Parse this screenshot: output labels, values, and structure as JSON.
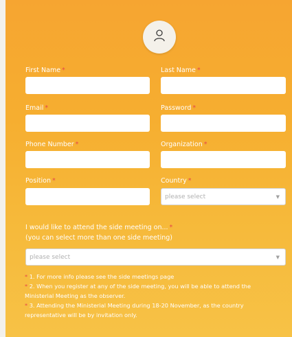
{
  "form": {
    "avatar_icon": "user-icon",
    "required_marker": "*",
    "fields": {
      "first_name": {
        "label": "First Name",
        "value": ""
      },
      "last_name": {
        "label": "Last Name",
        "value": ""
      },
      "email": {
        "label": "Email",
        "value": ""
      },
      "password": {
        "label": "Password",
        "value": ""
      },
      "phone_number": {
        "label": "Phone Number",
        "value": ""
      },
      "organization": {
        "label": "Organization",
        "value": ""
      },
      "position": {
        "label": "Position",
        "value": ""
      },
      "country": {
        "label": "Country",
        "placeholder": "please select"
      }
    },
    "side_meeting": {
      "label": "I would like to attend the side meeting on...",
      "sublabel": "(you can select more than one side meeting)",
      "placeholder": "please select"
    },
    "notes": [
      "1. For more info please see the side meetings page",
      "2. When you register at any of the side meeting, you will be able to attend the",
      "Ministerial Meeting as the observer.",
      "3. Attending the Ministerial Meeting during 18-20 November, as the country",
      "representative will be by invitation only."
    ]
  },
  "colors": {
    "background_top": "#f6a531",
    "background_bottom": "#f7c246",
    "required": "#e64848",
    "text": "#ffffff"
  }
}
